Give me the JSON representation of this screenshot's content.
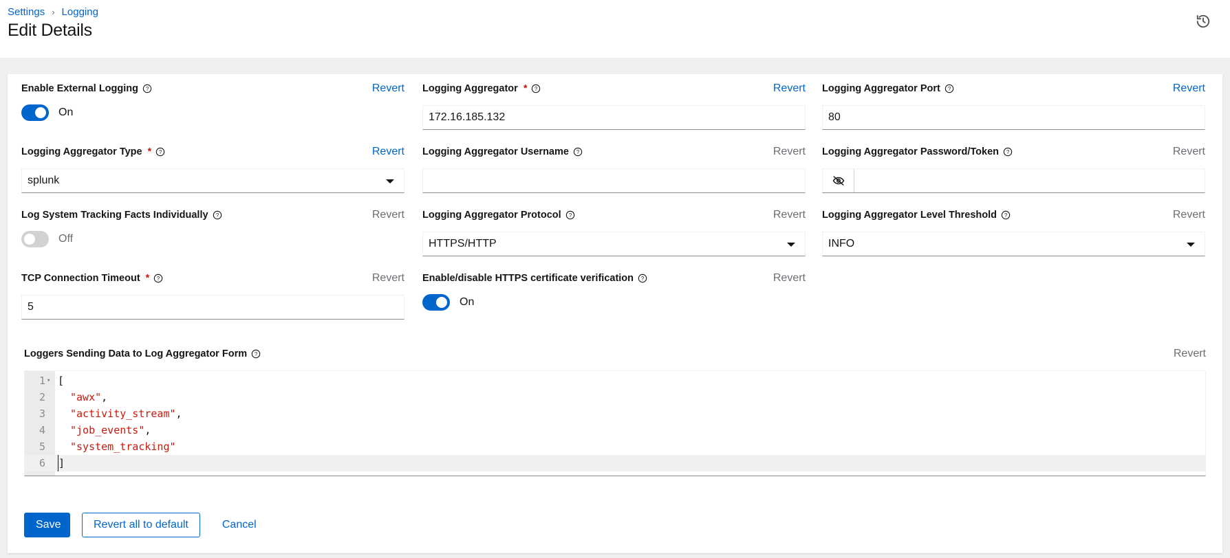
{
  "breadcrumb": {
    "settings": "Settings",
    "separator": "›",
    "logging": "Logging"
  },
  "header": {
    "title": "Edit Details",
    "history_icon": "history-icon"
  },
  "revert_label": "Revert",
  "fields": {
    "enable_external_logging": {
      "label": "Enable External Logging",
      "state": "On",
      "on": true,
      "revert_active": true
    },
    "logging_aggregator": {
      "label": "Logging Aggregator",
      "required": "*",
      "value": "172.16.185.132",
      "revert_active": true
    },
    "logging_aggregator_port": {
      "label": "Logging Aggregator Port",
      "value": "80",
      "revert_active": true
    },
    "logging_aggregator_type": {
      "label": "Logging Aggregator Type",
      "required": "*",
      "value": "splunk",
      "revert_active": true
    },
    "logging_aggregator_username": {
      "label": "Logging Aggregator Username",
      "value": "",
      "revert_active": false
    },
    "logging_aggregator_password": {
      "label": "Logging Aggregator Password/Token",
      "value": "",
      "revert_active": false
    },
    "log_system_tracking": {
      "label": "Log System Tracking Facts Individually",
      "state": "Off",
      "on": false,
      "revert_active": false
    },
    "logging_aggregator_protocol": {
      "label": "Logging Aggregator Protocol",
      "value": "HTTPS/HTTP",
      "revert_active": false
    },
    "logging_aggregator_level": {
      "label": "Logging Aggregator Level Threshold",
      "value": "INFO",
      "revert_active": false
    },
    "tcp_connection_timeout": {
      "label": "TCP Connection Timeout",
      "required": "*",
      "value": "5",
      "revert_active": false
    },
    "https_cert_verification": {
      "label": "Enable/disable HTTPS certificate verification",
      "state": "On",
      "on": true,
      "revert_active": false
    },
    "loggers": {
      "label": "Loggers Sending Data to Log Aggregator Form",
      "revert_active": false,
      "lines": [
        {
          "n": "1",
          "text": "["
        },
        {
          "n": "2",
          "text": "\"awx\"",
          "suffix": ","
        },
        {
          "n": "3",
          "text": "\"activity_stream\"",
          "suffix": ","
        },
        {
          "n": "4",
          "text": "\"job_events\"",
          "suffix": ","
        },
        {
          "n": "5",
          "text": "\"system_tracking\"",
          "suffix": ""
        },
        {
          "n": "6",
          "text": "]"
        }
      ]
    }
  },
  "actions": {
    "save": "Save",
    "revert_all": "Revert all to default",
    "cancel": "Cancel"
  },
  "colors": {
    "primary": "#0066cc",
    "required": "#c9190b",
    "string": "#c9190b",
    "muted": "#6a6e73"
  }
}
